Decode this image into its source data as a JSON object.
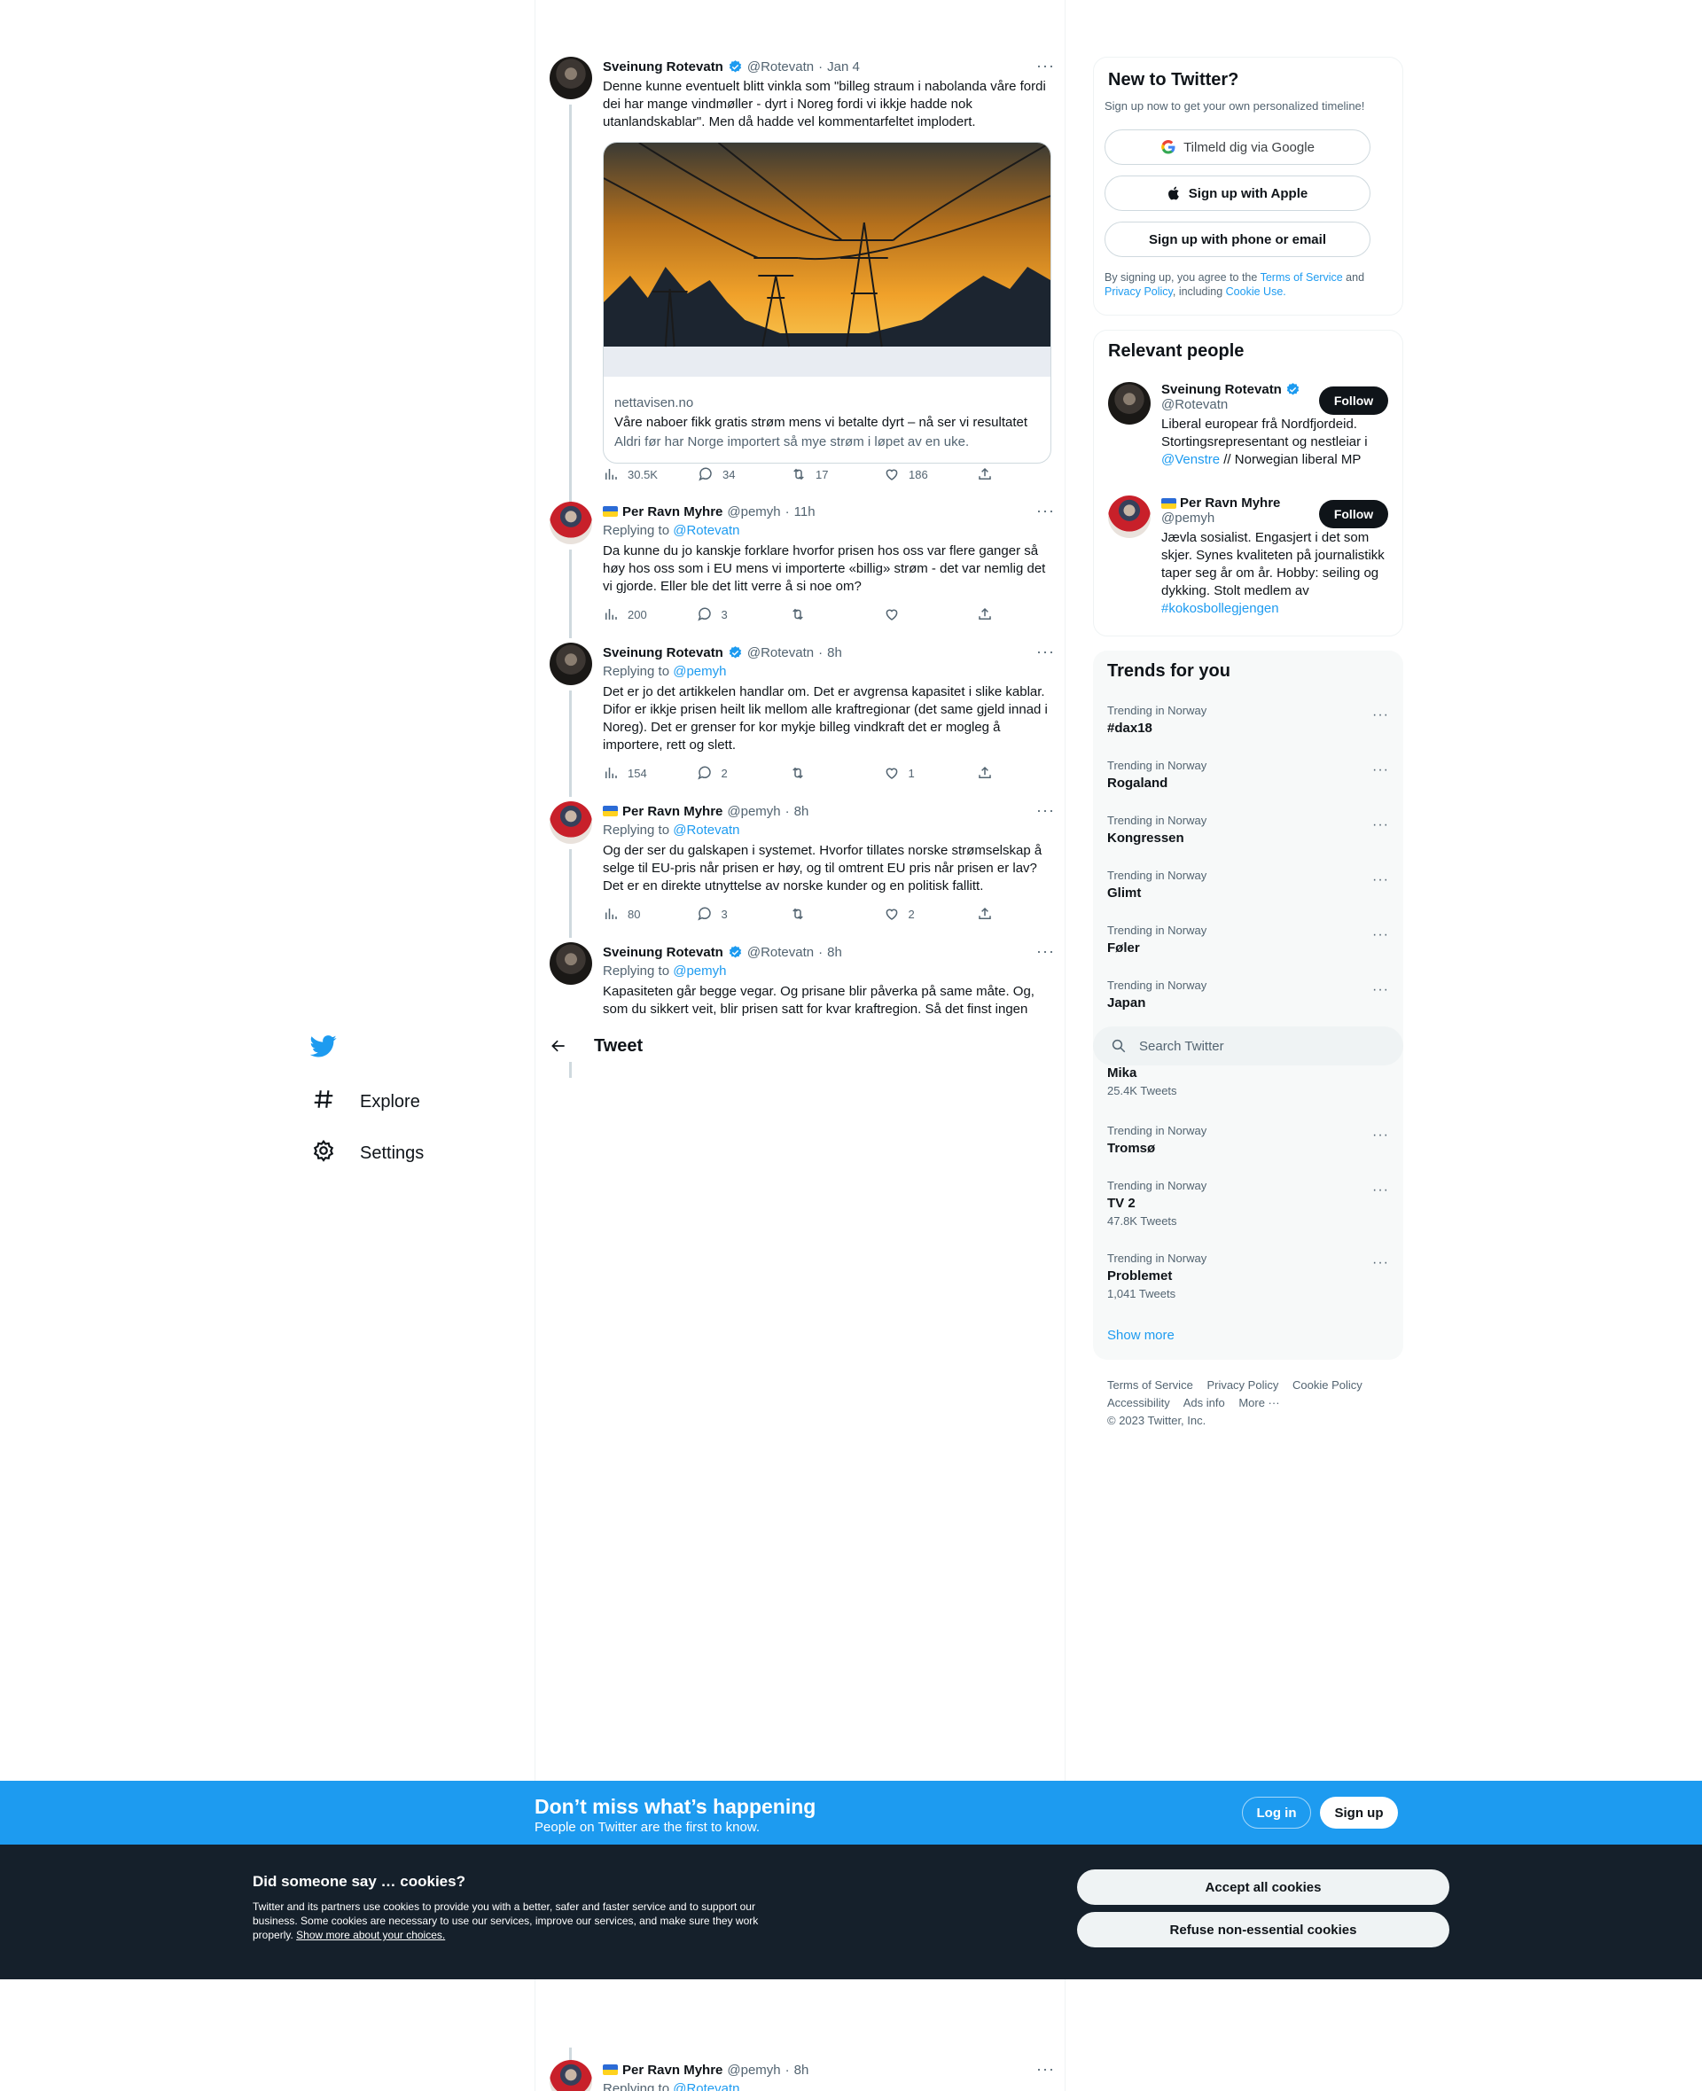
{
  "nav": {
    "explore": "Explore",
    "settings": "Settings"
  },
  "header": {
    "title": "Tweet"
  },
  "tweets": [
    {
      "name": "Sveinung Rotevatn",
      "handle": "@Rotevatn",
      "time": "Jan 4",
      "text": "Denne kunne eventuelt blitt vinkla som \"billeg straum i nabolanda våre fordi dei har mange vindmøller - dyrt i Noreg fordi vi ikkje hadde nok utanlandskablar\". Men då hadde vel kommentarfeltet implodert.",
      "card": {
        "domain": "nettavisen.no",
        "title": "Våre naboer fikk gratis strøm mens vi betalte dyrt – nå ser vi resultatet",
        "desc": "Aldri før har Norge importert så mye strøm i løpet av en uke."
      },
      "views": "30.5K",
      "replies": "34",
      "retweets": "17",
      "likes": "186"
    },
    {
      "name": "Per Ravn Myhre",
      "handle": "@pemyh",
      "time": "11h",
      "reply_label": "Replying to",
      "reply_to": "@Rotevatn",
      "text": "Da kunne du jo kanskje forklare hvorfor prisen hos oss var flere ganger så høy hos oss som i EU mens vi importerte «billig» strøm - det var nemlig det vi gjorde. Eller ble det litt verre å si noe om?",
      "views": "200",
      "replies": "3",
      "retweets": "",
      "likes": ""
    },
    {
      "name": "Sveinung Rotevatn",
      "handle": "@Rotevatn",
      "time": "8h",
      "reply_label": "Replying to",
      "reply_to": "@pemyh",
      "text": "Det er jo det artikkelen handlar om. Det er avgrensa kapasitet i slike kablar. Difor er ikkje prisen heilt lik mellom alle kraftregionar (det same gjeld innad i Noreg). Det er grenser for kor mykje billeg vindkraft det er mogleg å importere, rett og slett.",
      "views": "154",
      "replies": "2",
      "retweets": "",
      "likes": "1"
    },
    {
      "name": "Per Ravn Myhre",
      "handle": "@pemyh",
      "time": "8h",
      "reply_label": "Replying to",
      "reply_to": "@Rotevatn",
      "text": "Og der ser du galskapen i systemet. Hvorfor tillates norske strømselskap å selge til EU-pris når prisen er høy, og til omtrent EU pris når prisen er lav? Det er en direkte utnyttelse av norske kunder og en politisk fallitt.",
      "views": "80",
      "replies": "3",
      "retweets": "",
      "likes": "2"
    },
    {
      "name": "Sveinung Rotevatn",
      "handle": "@Rotevatn",
      "time": "8h",
      "reply_label": "Replying to",
      "reply_to": "@pemyh",
      "text": "Kapasiteten går begge vegar. Og prisane blir påverka på same måte. Og, som du sikkert veit, blir prisen satt for kvar kraftregion. Så det finst ingen"
    },
    {
      "name": "Per Ravn Myhre",
      "handle": "@pemyh",
      "time": "8h",
      "reply_label": "Replying to",
      "reply_to": "@Rotevatn"
    }
  ],
  "signup_panel": {
    "title": "New to Twitter?",
    "subtitle": "Sign up now to get your own personalized timeline!",
    "google": "Tilmeld dig via Google",
    "apple": "Sign up with Apple",
    "phone": "Sign up with phone or email",
    "terms_prefix": "By signing up, you agree to the",
    "terms_link": "Terms of Service",
    "and": "and",
    "privacy_link": "Privacy Policy",
    "including": ", including",
    "cookie_link": "Cookie Use."
  },
  "relevant": {
    "title": "Relevant people",
    "follow": "Follow",
    "people": [
      {
        "name": "Sveinung Rotevatn",
        "handle": "@Rotevatn",
        "bio_a": "Liberal europear frå Nordfjordeid. Stortingsrepresentant og nestleiar i",
        "bio_link": "@Venstre",
        "bio_b": "// Norwegian liberal MP"
      },
      {
        "name": "Per Ravn Myhre",
        "handle": "@pemyh",
        "bio_a": "Jævla sosialist. Engasjert i det som skjer. Synes kvaliteten på journalistikk taper seg år om år. Hobby: seiling og dykking. Stolt medlem av",
        "bio_link": "#kokosbollegjengen"
      }
    ]
  },
  "trends": {
    "title": "Trends for you",
    "items": [
      {
        "context": "Trending in Norway",
        "name": "#dax18",
        "count": ""
      },
      {
        "context": "Trending in Norway",
        "name": "Rogaland",
        "count": ""
      },
      {
        "context": "Trending in Norway",
        "name": "Kongressen",
        "count": ""
      },
      {
        "context": "Trending in Norway",
        "name": "Glimt",
        "count": ""
      },
      {
        "context": "Trending in Norway",
        "name": "Føler",
        "count": ""
      },
      {
        "context": "Trending in Norway",
        "name": "Japan",
        "count": ""
      },
      {
        "context": "",
        "name": "Mika",
        "count": "25.4K Tweets"
      },
      {
        "context": "Trending in Norway",
        "name": "Tromsø",
        "count": ""
      },
      {
        "context": "Trending in Norway",
        "name": "TV 2",
        "count": "47.8K Tweets"
      },
      {
        "context": "Trending in Norway",
        "name": "Problemet",
        "count": "1,041 Tweets"
      }
    ],
    "show_more": "Show more"
  },
  "search": {
    "placeholder": "Search Twitter"
  },
  "footer": {
    "links": [
      "Terms of Service",
      "Privacy Policy",
      "Cookie Policy",
      "Accessibility",
      "Ads info",
      "More ···"
    ],
    "copyright": "© 2023 Twitter, Inc."
  },
  "banner": {
    "title": "Don’t miss what’s happening",
    "subtitle": "People on Twitter are the first to know.",
    "login": "Log in",
    "signup": "Sign up"
  },
  "cookies": {
    "title": "Did someone say … cookies?",
    "text": "Twitter and its partners use cookies to provide you with a better, safer and faster service and to support our business. Some cookies are necessary to use our services, improve our services, and make sure they work properly.",
    "link": "Show more about your choices.",
    "accept": "Accept all cookies",
    "refuse": "Refuse non-essential cookies"
  },
  "colors": {
    "accent": "#1d9bf0",
    "text": "#0f1419",
    "muted": "#536471",
    "dark_bar": "#15202b"
  }
}
